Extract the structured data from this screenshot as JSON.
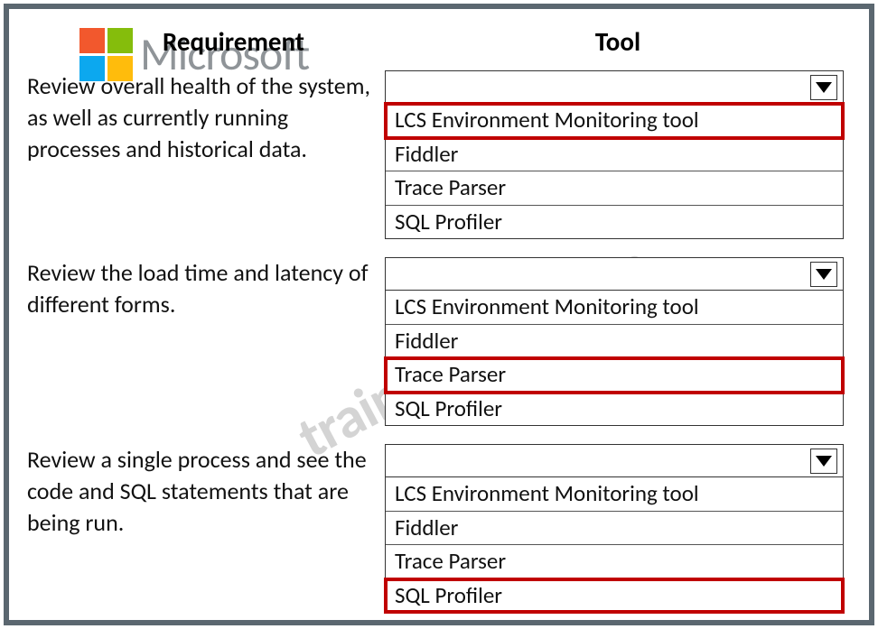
{
  "watermark": {
    "brand": "Microsoft",
    "diagonal": "trainingquiz.com"
  },
  "headers": {
    "requirement": "Requirement",
    "tool": "Tool"
  },
  "rows": [
    {
      "requirement": "Review overall health of the system, as well as currently running processes and historical data.",
      "options": [
        {
          "label": "LCS Environment Monitoring tool",
          "highlight": true
        },
        {
          "label": "Fiddler",
          "highlight": false
        },
        {
          "label": "Trace Parser",
          "highlight": false
        },
        {
          "label": "SQL Profiler",
          "highlight": false
        }
      ]
    },
    {
      "requirement": "Review the load time and latency of different forms.",
      "options": [
        {
          "label": "LCS Environment Monitoring tool",
          "highlight": false
        },
        {
          "label": "Fiddler",
          "highlight": false
        },
        {
          "label": "Trace Parser",
          "highlight": true
        },
        {
          "label": "SQL Profiler",
          "highlight": false
        }
      ]
    },
    {
      "requirement": "Review a single process and see the code and SQL statements that are being run.",
      "options": [
        {
          "label": "LCS Environment Monitoring tool",
          "highlight": false
        },
        {
          "label": "Fiddler",
          "highlight": false
        },
        {
          "label": "Trace Parser",
          "highlight": false
        },
        {
          "label": "SQL Profiler",
          "highlight": true
        }
      ]
    }
  ]
}
